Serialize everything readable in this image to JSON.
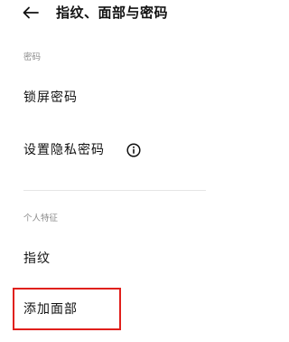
{
  "header": {
    "back_icon": "arrow-left-icon",
    "title": "指纹、面部与密码"
  },
  "passcode_section": {
    "label": "密码",
    "items": [
      {
        "label": "锁屏密码"
      },
      {
        "label": "设置隐私密码",
        "icon": "info-icon"
      }
    ]
  },
  "biometric_section": {
    "label": "个人特征",
    "items": [
      {
        "label": "指纹"
      },
      {
        "label": "添加面部"
      }
    ]
  },
  "colors": {
    "highlight": "#e0201c",
    "section_label": "#8a8a8a",
    "text": "#111111"
  }
}
